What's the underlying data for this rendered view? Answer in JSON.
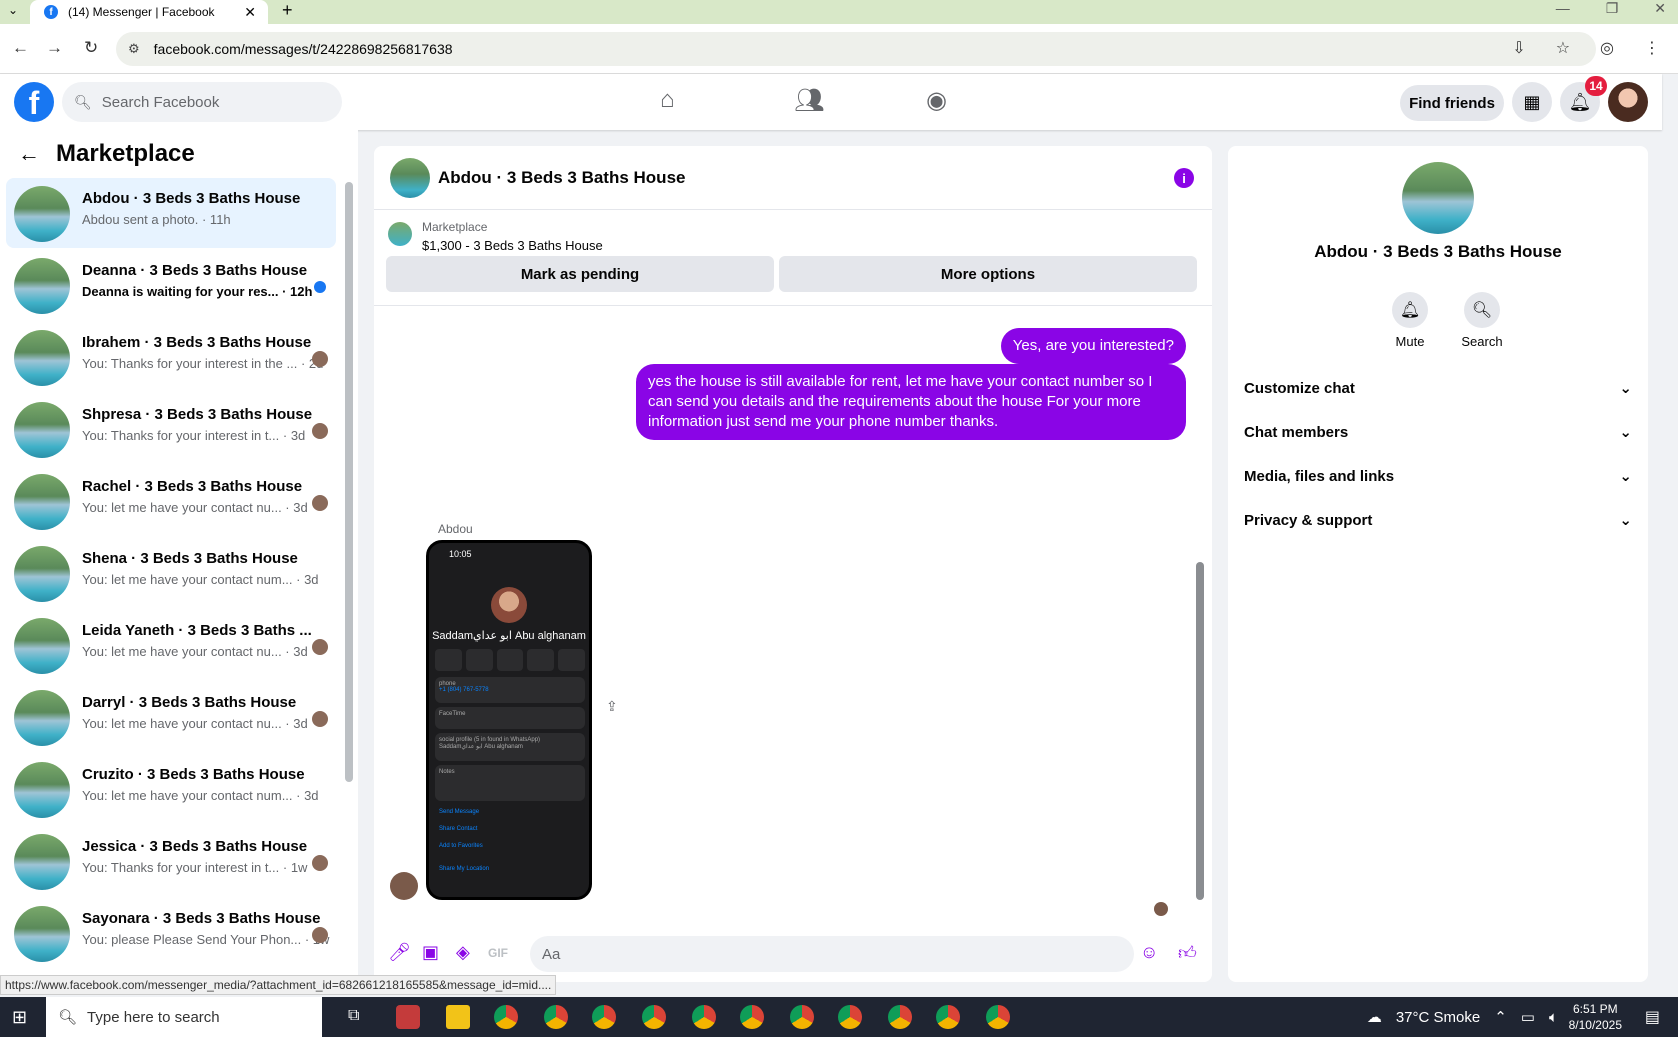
{
  "browser": {
    "tab_title": "(14) Messenger | Facebook",
    "url": "facebook.com/messages/t/24228698256817638",
    "status_url": "https://www.facebook.com/messenger_media/?attachment_id=682661218165585&message_id=mid...."
  },
  "header": {
    "search_placeholder": "Search Facebook",
    "find_friends_label": "Find friends",
    "notification_count": "14"
  },
  "sidebar": {
    "title": "Marketplace",
    "conversations": [
      {
        "name": "Abdou · 3 Beds 3 Baths House",
        "snippet": "Abdou sent a photo. · 11h",
        "active": true
      },
      {
        "name": "Deanna · 3 Beds 3 Baths House",
        "snippet": "Deanna is waiting for your res... · 12h",
        "unread": true
      },
      {
        "name": "Ibrahem · 3 Beds 3 Baths House",
        "snippet": "You: Thanks for your interest in the ... · 2d"
      },
      {
        "name": "Shpresa · 3 Beds 3 Baths House",
        "snippet": "You: Thanks for your interest in t... · 3d"
      },
      {
        "name": "Rachel · 3 Beds 3 Baths House",
        "snippet": "You: let me have your contact nu... · 3d"
      },
      {
        "name": "Shena · 3 Beds 3 Baths House",
        "snippet": "You: let me have your contact num... · 3d"
      },
      {
        "name": "Leida Yaneth · 3 Beds 3 Baths ...",
        "snippet": "You: let me have your contact nu... · 3d"
      },
      {
        "name": "Darryl · 3 Beds 3 Baths House",
        "snippet": "You: let me have your contact nu... · 3d"
      },
      {
        "name": "Cruzito · 3 Beds 3 Baths House",
        "snippet": "You: let me have your contact num... · 3d"
      },
      {
        "name": "Jessica · 3 Beds 3 Baths House",
        "snippet": "You: Thanks for your interest in t... · 1w"
      },
      {
        "name": "Sayonara · 3 Beds 3 Baths House",
        "snippet": "You: please Please Send Your Phon... · 1w"
      }
    ]
  },
  "chat": {
    "title": "Abdou · 3 Beds 3 Baths House",
    "listing_source": "Marketplace",
    "listing_price": "$1,300 - 3 Beds 3 Baths House",
    "mark_pending_label": "Mark as pending",
    "more_options_label": "More options",
    "messages_out": [
      "Yes, are you interested?",
      "yes the house is still available for rent, let me have your contact number so I can send you details and the requirements about the house For  your  more  information  just send  me   your  phone  number thanks."
    ],
    "sender_label": "Abdou",
    "attachment": {
      "time": "10:05",
      "contact_name": "Saddamابو عداي Abu alghanam",
      "phone_label": "phone",
      "phone_number": "+1 (804) 767-5778",
      "facetime_label": "FaceTime",
      "social_label": "social profile (5 in found in WhatsApp)",
      "social_value": "Saddamابو عداي Abu alghanam",
      "notes_label": "Notes",
      "send_message": "Send Message",
      "share_contact": "Share Contact",
      "add_favorites": "Add to Favorites",
      "share_location": "Share My Location"
    },
    "composer_placeholder": "Aa"
  },
  "info_panel": {
    "name": "Abdou · 3 Beds 3 Baths House",
    "mute_label": "Mute",
    "search_label": "Search",
    "sections": [
      "Customize chat",
      "Chat members",
      "Media, files and links",
      "Privacy & support"
    ]
  },
  "taskbar": {
    "search_placeholder": "Type here to search",
    "weather": "37°C  Smoke",
    "time": "6:51 PM",
    "date": "8/10/2025"
  },
  "colors": {
    "messenger_purple": "#8a05e6",
    "facebook_blue": "#1877f2"
  }
}
